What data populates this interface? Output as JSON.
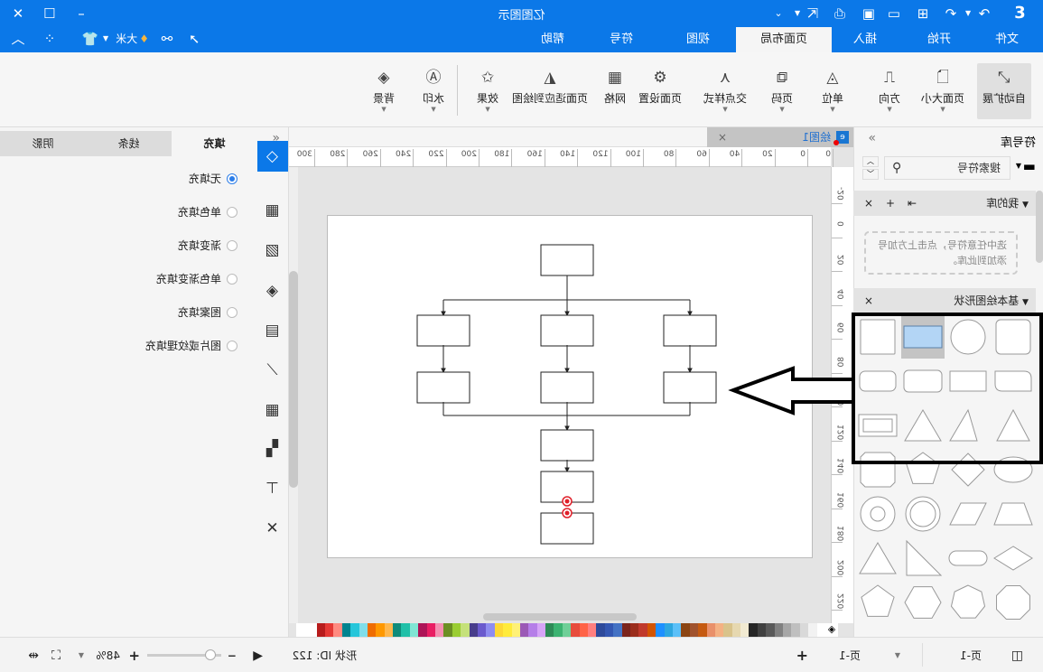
{
  "app": {
    "title": "亿图图示"
  },
  "colors": {
    "accent": "#0b78e8",
    "selected_shape_fill": "#b3d5f5",
    "connection_point": "#e0202a"
  },
  "quick_access": [
    "logo-icon",
    "redo-icon",
    "undo-icon",
    "new-icon",
    "open-icon",
    "save-icon",
    "print-icon",
    "export-icon",
    "more-icon"
  ],
  "window_controls": [
    "minimize-icon",
    "maximize-icon",
    "close-icon"
  ],
  "menu_tabs": [
    {
      "label": "文件"
    },
    {
      "label": "开始"
    },
    {
      "label": "插入"
    },
    {
      "label": "页面布局",
      "active": true
    },
    {
      "label": "视图"
    },
    {
      "label": "符号"
    },
    {
      "label": "帮助"
    }
  ],
  "user": {
    "name": "大米"
  },
  "ribbon": [
    {
      "label": "自动扩展",
      "active": true
    },
    {
      "label": "页面大小",
      "dropdown": true
    },
    {
      "label": "方向",
      "dropdown": true
    },
    {
      "label": "单位",
      "dropdown": true
    },
    {
      "label": "页码",
      "dropdown": true
    },
    {
      "label": "交点样式",
      "dropdown": true
    },
    {
      "label": "页面设置"
    },
    {
      "label": "网格"
    },
    {
      "label": "页面适应到绘图"
    },
    {
      "label": "效果",
      "dropdown": true
    },
    {
      "label": "水印",
      "dropdown": true
    },
    {
      "label": "背景",
      "dropdown": true
    }
  ],
  "library": {
    "title": "符号库",
    "search_placeholder": "搜索符号",
    "my_library": "我的库",
    "my_library_hint": "选中任意符号，点击上方加号添加到此库。",
    "basic_shapes": "基本绘图形状",
    "shapes": [
      "rounded-square",
      "circle",
      "rectangle",
      "square",
      "round-corner-rect",
      "snip-rect",
      "rounded-rect",
      "rounded-rect-2",
      "triangle",
      "right-triangle",
      "triangle-2",
      "frame",
      "ellipse",
      "diamond",
      "pentagon",
      "octagon-tall",
      "trapezoid",
      "parallelogram",
      "double-circle",
      "donut",
      "rhombus",
      "stadium",
      "corner-triangle",
      "rounded-triangle",
      "octagon",
      "heptagon",
      "hexagon",
      "pentagon-round"
    ]
  },
  "canvas": {
    "doc_tab": "绘图1",
    "hruler": [
      "0",
      "0",
      "20",
      "40",
      "60",
      "80",
      "100",
      "120",
      "140",
      "160",
      "180",
      "200",
      "220",
      "240",
      "260",
      "280",
      "300"
    ],
    "vruler": [
      "-20",
      "0",
      "20",
      "40",
      "60",
      "80",
      "100",
      "120",
      "140",
      "160",
      "180",
      "200",
      "220"
    ]
  },
  "palette": [
    "#ffffff",
    "#f2f2f2",
    "#d9d9d9",
    "#bfbfbf",
    "#a6a6a6",
    "#808080",
    "#595959",
    "#404040",
    "#262626",
    "#f1ead2",
    "#e6d8b0",
    "#d9c38b",
    "#f4b183",
    "#e9906a",
    "#c55a11",
    "#a0522d",
    "#8b4513",
    "#5bc0f8",
    "#2ea7e0",
    "#1e90ff",
    "#d35400",
    "#c0392b",
    "#9b2d1c",
    "#7b241c",
    "#4472c4",
    "#3457b2",
    "#2e4a9b",
    "#ff7f7f",
    "#ff6347",
    "#e74c3c",
    "#6fcf97",
    "#3cb371",
    "#2e8b57",
    "#d6a4f7",
    "#b57ee8",
    "#9b59b6",
    "#fff176",
    "#ffeb3b",
    "#fdd835",
    "#8e8cf0",
    "#6a5acd",
    "#483d8b",
    "#c5e17a",
    "#9acd32",
    "#6b8e23",
    "#f48fb1",
    "#e91e63",
    "#ad1457",
    "#80e5d4",
    "#20c0a8",
    "#0f8b7a",
    "#ffb74d",
    "#ff9800",
    "#ef6c00",
    "#80deea",
    "#26c6da",
    "#00838f",
    "#ff8a80",
    "#e53935",
    "#b71c1c"
  ],
  "properties": {
    "tabs": [
      {
        "label": "填充",
        "active": true
      },
      {
        "label": "线条"
      },
      {
        "label": "阴影"
      }
    ],
    "fill_options": [
      {
        "label": "无填充",
        "selected": true
      },
      {
        "label": "单色填充"
      },
      {
        "label": "渐变填充"
      },
      {
        "label": "单色渐变填充"
      },
      {
        "label": "图案填充"
      },
      {
        "label": "图片或纹理填充"
      }
    ]
  },
  "side_strip": [
    "fill-icon",
    "grid-icon",
    "image-icon",
    "layers-icon",
    "document-icon",
    "chart-icon",
    "table-icon",
    "puzzle-icon",
    "presentation-icon",
    "connector-icon"
  ],
  "status": {
    "page_select": "页-1",
    "page_tab": "页-1",
    "shape_id": "形状 ID: 122",
    "zoom": "48%"
  }
}
